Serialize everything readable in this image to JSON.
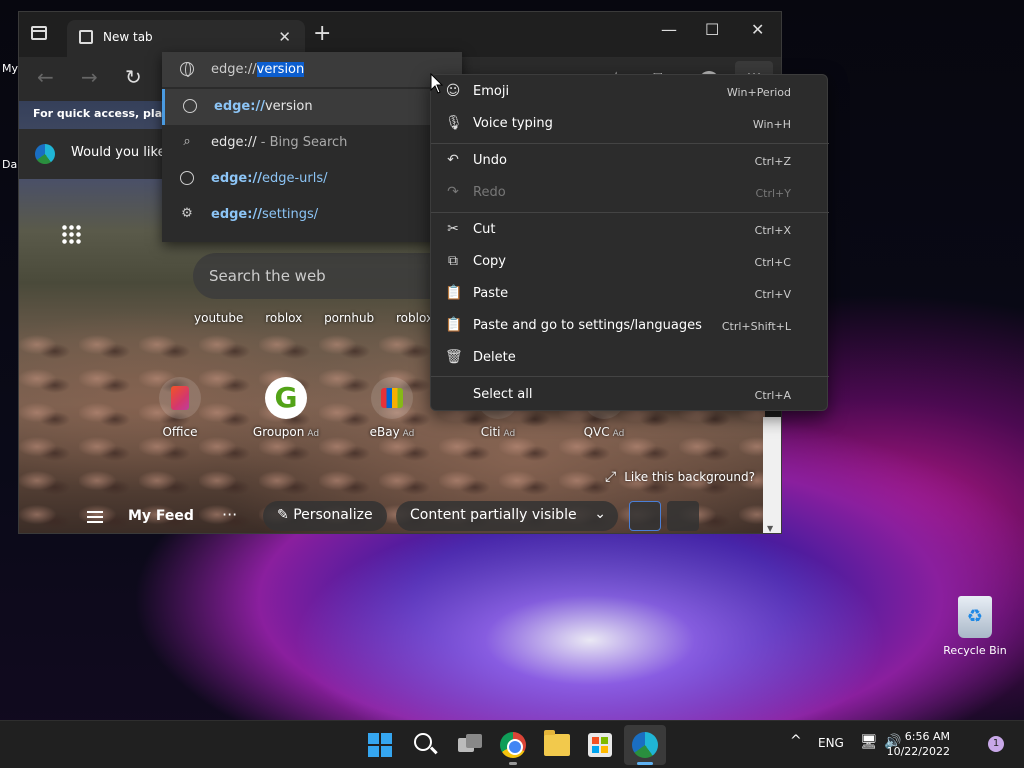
{
  "desktop": {
    "partial_labels": [
      "My",
      "Da"
    ],
    "recycle_bin_label": "Recycle Bin"
  },
  "browser": {
    "tab_title": "New tab",
    "tab_close_glyph": "✕",
    "new_tab_glyph": "+",
    "window_controls": {
      "minimize": "—",
      "maximize": "☐",
      "close": "✕"
    },
    "more_glyph": "···",
    "address": {
      "prefix": "edge://",
      "selected": "version"
    },
    "suggestions": [
      {
        "bold": "edge://",
        "rest": "version",
        "suffix": "",
        "icon": "globe-icon"
      },
      {
        "bold": "edge://",
        "rest": "",
        "suffix": " - Bing Search",
        "icon": "search-icon"
      },
      {
        "bold": "edge://",
        "rest": "edge-urls/",
        "suffix": "",
        "icon": "globe-icon"
      },
      {
        "bold": "edge://",
        "rest": "settings/",
        "suffix": "",
        "icon": "gear-icon"
      }
    ],
    "quick_access_text": "For quick access, place y",
    "banner_text": "Would you like t",
    "search_placeholder": "Search the web",
    "search_suggestions": [
      "youtube",
      "roblox",
      "pornhub",
      "roblox downl"
    ],
    "tiles": [
      {
        "label": "Office",
        "ad": ""
      },
      {
        "label": "Groupon",
        "ad": "Ad"
      },
      {
        "label": "eBay",
        "ad": "Ad"
      },
      {
        "label": "Citi",
        "ad": "Ad"
      },
      {
        "label": "QVC",
        "ad": "Ad"
      }
    ],
    "like_background": "Like this background?",
    "feed": {
      "my_feed": "My Feed",
      "more": "···",
      "personalize": "Personalize",
      "content_visibility": "Content partially visible"
    }
  },
  "context_menu": [
    {
      "label": "Emoji",
      "shortcut": "Win+Period",
      "icon": "emoji-icon",
      "disabled": false
    },
    {
      "label": "Voice typing",
      "shortcut": "Win+H",
      "icon": "microphone-icon",
      "disabled": false
    },
    {
      "label": "Undo",
      "shortcut": "Ctrl+Z",
      "icon": "undo-icon",
      "disabled": false
    },
    {
      "label": "Redo",
      "shortcut": "Ctrl+Y",
      "icon": "redo-icon",
      "disabled": true
    },
    {
      "label": "Cut",
      "shortcut": "Ctrl+X",
      "icon": "scissors-icon",
      "disabled": false
    },
    {
      "label": "Copy",
      "shortcut": "Ctrl+C",
      "icon": "copy-icon",
      "disabled": false
    },
    {
      "label": "Paste",
      "shortcut": "Ctrl+V",
      "icon": "paste-icon",
      "disabled": false
    },
    {
      "label": "Paste and go to settings/languages",
      "shortcut": "Ctrl+Shift+L",
      "icon": "paste-go-icon",
      "disabled": false
    },
    {
      "label": "Delete",
      "shortcut": "",
      "icon": "trash-icon",
      "disabled": false
    },
    {
      "label": "Select all",
      "shortcut": "Ctrl+A",
      "icon": "",
      "disabled": false
    }
  ],
  "taskbar": {
    "language": "ENG",
    "time": "6:56 AM",
    "date": "10/22/2022",
    "notification_count": "1",
    "tray_chevron": "^"
  },
  "colors": {
    "accent": "#0c5ecf",
    "link": "#8cc4f5",
    "menu_bg": "#2c2c2c"
  }
}
